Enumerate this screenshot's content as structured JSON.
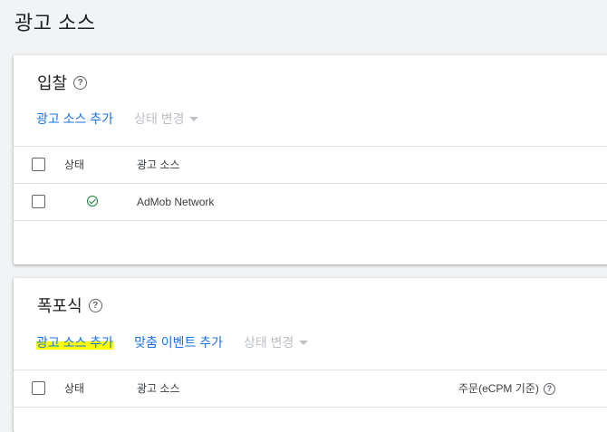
{
  "page": {
    "title": "광고 소스"
  },
  "bidding": {
    "title": "입찰",
    "help_icon": "help-circle-icon",
    "actions": {
      "add_source": "광고 소스 추가",
      "change_status": "상태 변경"
    },
    "columns": {
      "status": "상태",
      "ad_source": "광고 소스"
    },
    "rows": [
      {
        "status": "active",
        "status_icon": "check-circle-icon",
        "ad_source": "AdMob Network"
      }
    ]
  },
  "waterfall": {
    "title": "폭포식",
    "help_icon": "help-circle-icon",
    "actions": {
      "add_source": "광고 소스 추가",
      "add_custom_event": "맞춤 이벤트 추가",
      "change_status": "상태 변경"
    },
    "columns": {
      "status": "상태",
      "ad_source": "광고 소스",
      "order": "주문(eCPM 기준)"
    }
  },
  "colors": {
    "link": "#1a73e8",
    "disabled": "#bdc1c6",
    "success": "#188038",
    "highlight": "#ffff00"
  }
}
